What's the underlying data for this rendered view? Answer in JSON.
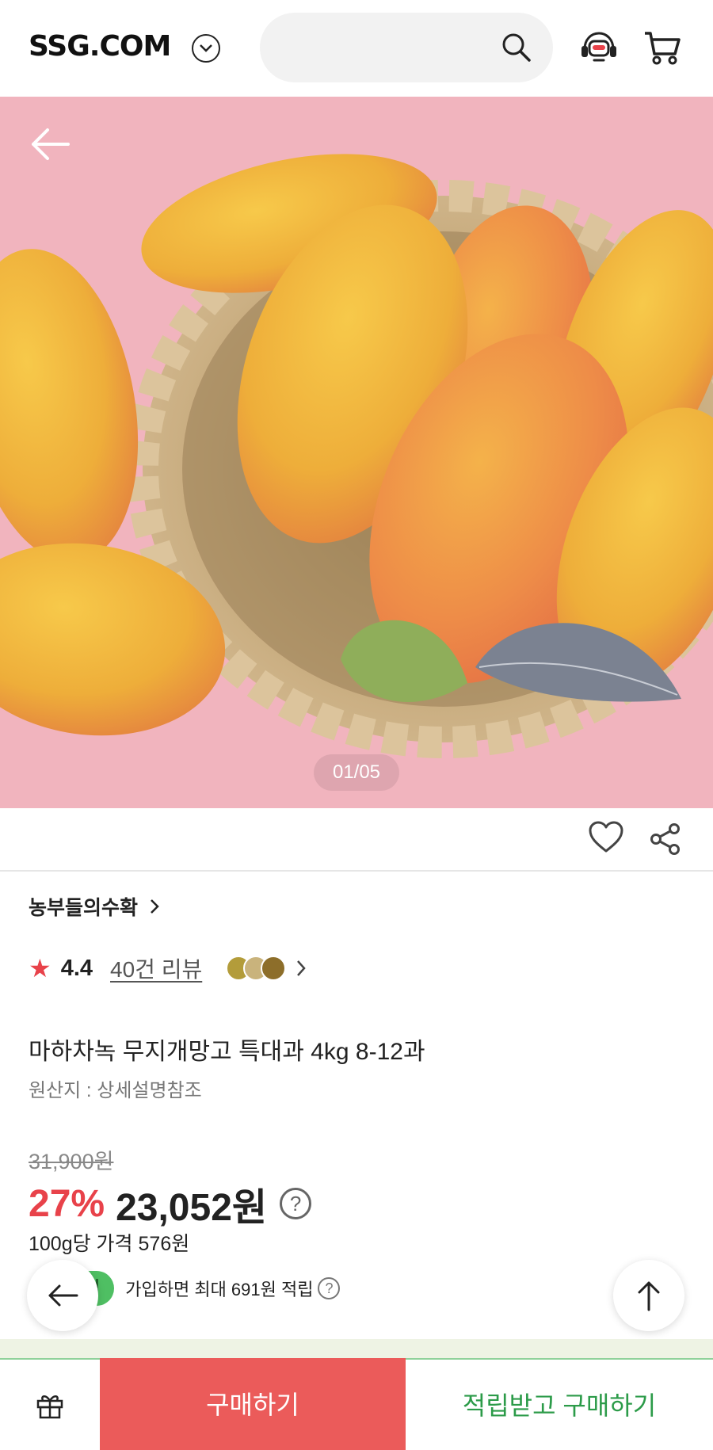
{
  "header": {
    "logo": "SSG.COM",
    "search_placeholder": ""
  },
  "gallery": {
    "pager": "01/05"
  },
  "product": {
    "brand": "농부들의수확",
    "rating": "4.4",
    "review_count": "40건 리뷰",
    "title": "마하차녹 무지개망고 특대과 4kg 8-12과",
    "origin": "원산지 : 상세설명참조",
    "original_price": "31,900원",
    "discount": "27%",
    "sale_price": "23,052원",
    "unit_price": "100g당 가격 576원",
    "point_badge": "립",
    "points_text": "가입하면 최대 691원 적립"
  },
  "bottom": {
    "buy_label": "구매하기",
    "save_buy_label": "적립받고 구매하기"
  },
  "colors": {
    "accent_red": "#e8424a",
    "buy_button": "#eb5b5a",
    "points_green": "#2c9b49",
    "hero_background": "#f2b3bd"
  }
}
